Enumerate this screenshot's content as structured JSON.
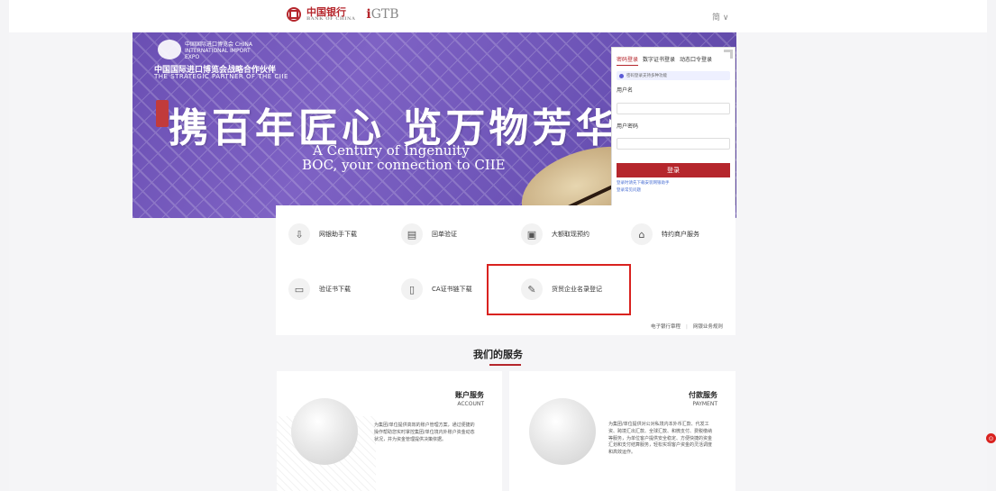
{
  "header": {
    "boc_name": "中国银行",
    "boc_sub": "BANK OF CHINA",
    "igtb_label": "GTB",
    "lang_label": "简 ∨"
  },
  "banner": {
    "expo_name": "中国国际进口博览会 CHINA INTERNATIONAL IMPORT EXPO",
    "partner_cn": "中国国际进口博览会战略合作伙伴",
    "partner_en": "THE STRATEGIC PARTNER OF THE CIIE",
    "slogan_cn": "携百年匠心 览万物芳华",
    "slogan_en_1": "A Century of Ingenuity",
    "slogan_en_2": "BOC, your connection to CIIE"
  },
  "login": {
    "tabs": [
      "密码登录",
      "数字证书登录",
      "动态口令登录"
    ],
    "note": "密码登录支持多种功能",
    "username_label": "用户名",
    "password_label": "用户密码",
    "submit_label": "登录",
    "link_1": "登录时请先下载安装网银助手",
    "link_2": "登录常见问题"
  },
  "shortcuts": [
    {
      "label": "网银助手下载",
      "icon": "download-icon"
    },
    {
      "label": "回单验证",
      "icon": "receipt-icon"
    },
    {
      "label": "大额取现预约",
      "icon": "cash-icon"
    },
    {
      "label": "特约商户服务",
      "icon": "shop-icon"
    },
    {
      "label": "验证书下载",
      "icon": "cert-icon"
    },
    {
      "label": "CA证书链下载",
      "icon": "ca-cert-icon"
    },
    {
      "label": "货贸企业名录登记",
      "icon": "register-icon"
    }
  ],
  "ebank_links": {
    "link_1": "电子银行章程",
    "sep": "|",
    "link_2": "网银业务规则"
  },
  "services": {
    "title": "我们的服务",
    "cards": [
      {
        "title": "账户服务",
        "sub": "ACCOUNT",
        "desc": "为集团/单位提供高效的账户管理方案，通过便捷的操作帮助您实时掌控集团/单位境内外账户资金动态状况，并为资金管理提供决策依据。"
      },
      {
        "title": "付款服务",
        "sub": "PAYMENT",
        "desc": "为集团/单位提供对公对私境内本外币汇款、代发工资、跨境汇出汇款、全球汇款、和微支付、费税缴纳等服务，为单位客户提供安全稳定、方便快捷的资金汇划和支付结算服务，轻松实现客户资金的灵活调度和高效运作。"
      }
    ]
  },
  "colors": {
    "brand_red": "#b5262c",
    "banner_purple": "#6b52b5",
    "highlight_red": "#d9221f"
  }
}
